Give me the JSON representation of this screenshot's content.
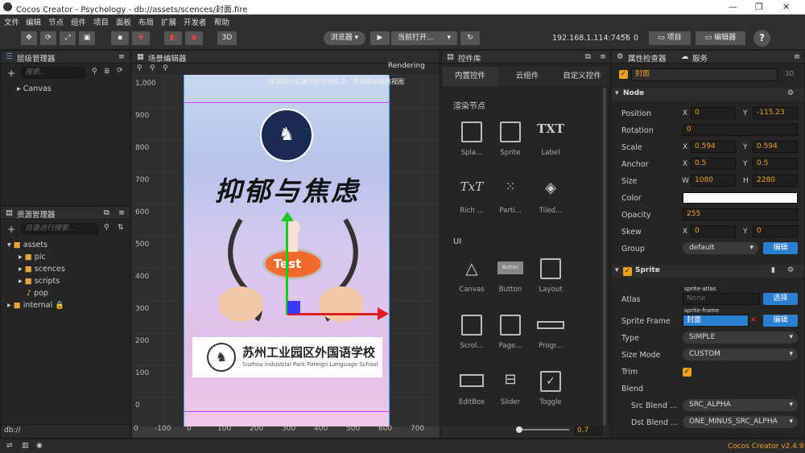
{
  "window": {
    "title": "Cocos Creator - Psychology - db://assets/scences/封面.fire",
    "min": "—",
    "max": "❐",
    "close": "✕"
  },
  "menu": [
    "文件",
    "编辑",
    "节点",
    "组件",
    "项目",
    "面板",
    "布局",
    "扩展",
    "开发者",
    "帮助"
  ],
  "toolbar": {
    "browser": "浏览器 ▾",
    "play": "▶",
    "scene_select": "当前打开...",
    "scene_arrow": "▾",
    "refresh": "↻",
    "ip": "192.168.1.114:7456",
    "wifi_count": "0",
    "project_btn": "项目",
    "editor_btn": "编辑器",
    "help": "?",
    "mode3d": "3D"
  },
  "hierarchy": {
    "title": "层级管理器",
    "search_placeholder": "搜索...",
    "root": "Canvas"
  },
  "assets": {
    "title": "资源管理器",
    "search_placeholder": "目录进行搜索...",
    "items": [
      "assets",
      "pic",
      "scences",
      "scripts",
      "pop",
      "internal"
    ],
    "path": "db://"
  },
  "scene": {
    "title": "场景编辑器",
    "hint": "使用鼠标右键平移视窗焦点，使用滚轮缩放视图",
    "rendering": "Rendering",
    "zoom": "0.7",
    "y_ticks": [
      "1,000",
      "900",
      "800",
      "700",
      "600",
      "500",
      "400",
      "300",
      "200",
      "100",
      "0"
    ],
    "x_ticks": [
      "0",
      "-100",
      "0",
      "100",
      "200",
      "300",
      "400",
      "500",
      "600",
      "700"
    ],
    "cover_title": "抑郁与焦虑",
    "test_label": "Test",
    "school_cn": "苏州工业园区外国语学校",
    "school_en": "Suzhou Industrial Park Foreign Language School"
  },
  "library": {
    "title": "控件库",
    "tabs": [
      "内置控件",
      "云组件",
      "自定义控件"
    ],
    "section_render": "渲染节点",
    "section_ui": "UI",
    "render_items": [
      "Spla...",
      "Sprite",
      "Label",
      "Rich ...",
      "Parti...",
      "Tiled..."
    ],
    "ui_items": [
      "Canvas",
      "Button",
      "Layout",
      "Scrol...",
      "Page...",
      "Progr...",
      "EditBox",
      "Slider",
      "Toggle"
    ],
    "label_txt": "TXT",
    "rich_txt": "TxT",
    "button_inner": "Button"
  },
  "inspector": {
    "title": "属性检查器",
    "services": "服务",
    "node_name": "封面",
    "tag3d": "3D",
    "node_section": "Node",
    "position": {
      "label": "Position",
      "x": "0",
      "y": "-115.23"
    },
    "rotation": {
      "label": "Rotation",
      "v": "0"
    },
    "scale": {
      "label": "Scale",
      "x": "0.594",
      "y": "0.594"
    },
    "anchor": {
      "label": "Anchor",
      "x": "0.5",
      "y": "0.5"
    },
    "size": {
      "label": "Size",
      "w": "1080",
      "h": "2280"
    },
    "color": {
      "label": "Color",
      "value": "#ffffff"
    },
    "opacity": {
      "label": "Opacity",
      "v": "255"
    },
    "skew": {
      "label": "Skew",
      "x": "0",
      "y": "0"
    },
    "group": {
      "label": "Group",
      "v": "default",
      "btn": "编辑"
    },
    "sprite_section": "Sprite",
    "atlas": {
      "label": "Atlas",
      "tag": "sprite-atlas",
      "v": "None",
      "btn": "选择"
    },
    "frame": {
      "label": "Sprite Frame",
      "tag": "sprite-frame",
      "v": "封面",
      "btn": "编辑"
    },
    "type": {
      "label": "Type",
      "v": "SIMPLE"
    },
    "sizemode": {
      "label": "Size Mode",
      "v": "CUSTOM"
    },
    "trim": {
      "label": "Trim"
    },
    "blend": {
      "label": "Blend"
    },
    "src": {
      "label": "Src Blend ...",
      "v": "SRC_ALPHA"
    },
    "dst": {
      "label": "Dst Blend ...",
      "v": "ONE_MINUS_SRC_ALPHA"
    },
    "xl": "X",
    "yl": "Y",
    "wl": "W",
    "hl": "H"
  },
  "status": {
    "version": "Cocos Creator v2.4.9"
  },
  "colors": {
    "accent": "#f0a020",
    "blue": "#2b7fcf"
  }
}
